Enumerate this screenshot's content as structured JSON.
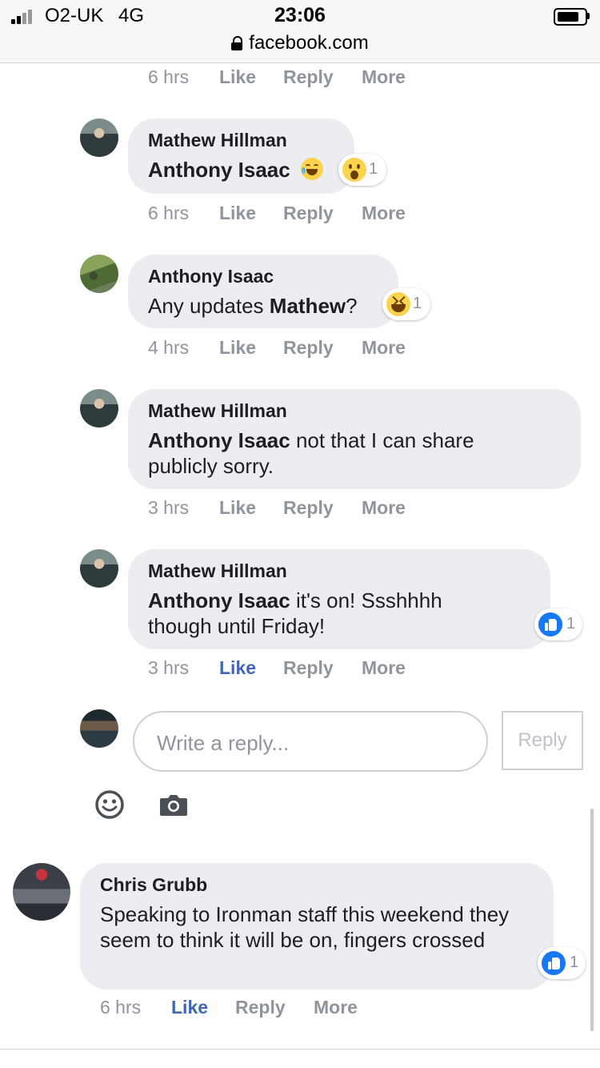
{
  "status_bar": {
    "carrier": "O2-UK",
    "network": "4G",
    "time": "23:06",
    "url": "facebook.com"
  },
  "top_actions": {
    "time": "6 hrs",
    "like": "Like",
    "reply": "Reply",
    "more": "More"
  },
  "comments": [
    {
      "author": "Mathew Hillman",
      "mention": "Anthony Isaac",
      "text": "",
      "reaction": {
        "icon": "wow-emoji-icon",
        "count": "1"
      },
      "inline_emoji": "laughing-emoji-icon",
      "actions": {
        "time": "6 hrs",
        "like": "Like",
        "reply": "Reply",
        "more": "More"
      }
    },
    {
      "author": "Anthony Isaac",
      "text_prefix": "Any updates ",
      "mention": "Mathew",
      "text_suffix": "?",
      "reaction": {
        "icon": "laughing-emoji-icon",
        "count": "1"
      },
      "actions": {
        "time": "4 hrs",
        "like": "Like",
        "reply": "Reply",
        "more": "More"
      }
    },
    {
      "author": "Mathew Hillman",
      "mention": "Anthony Isaac",
      "text": " not that I can share publicly sorry.",
      "actions": {
        "time": "3 hrs",
        "like": "Like",
        "reply": "Reply",
        "more": "More"
      }
    },
    {
      "author": "Mathew Hillman",
      "mention": "Anthony Isaac",
      "text": " it's on! Ssshhhh though until Friday!",
      "reaction": {
        "icon": "like-icon",
        "count": "1"
      },
      "actions": {
        "time": "3 hrs",
        "like": "Like",
        "reply": "Reply",
        "more": "More",
        "liked": true
      }
    }
  ],
  "reply_box": {
    "placeholder": "Write a reply...",
    "button": "Reply"
  },
  "chris": {
    "author": "Chris Grubb",
    "text": "Speaking to Ironman staff this weekend they seem to think it will be on, fingers crossed",
    "reaction": {
      "icon": "like-icon",
      "count": "1"
    },
    "actions": {
      "time": "6 hrs",
      "like": "Like",
      "reply": "Reply",
      "more": "More",
      "liked": true
    }
  },
  "colors": {
    "bubble": "#ebedf0",
    "link_blue": "#4267b2",
    "meta_gray": "#90949c",
    "like_blue": "#1877f2"
  }
}
